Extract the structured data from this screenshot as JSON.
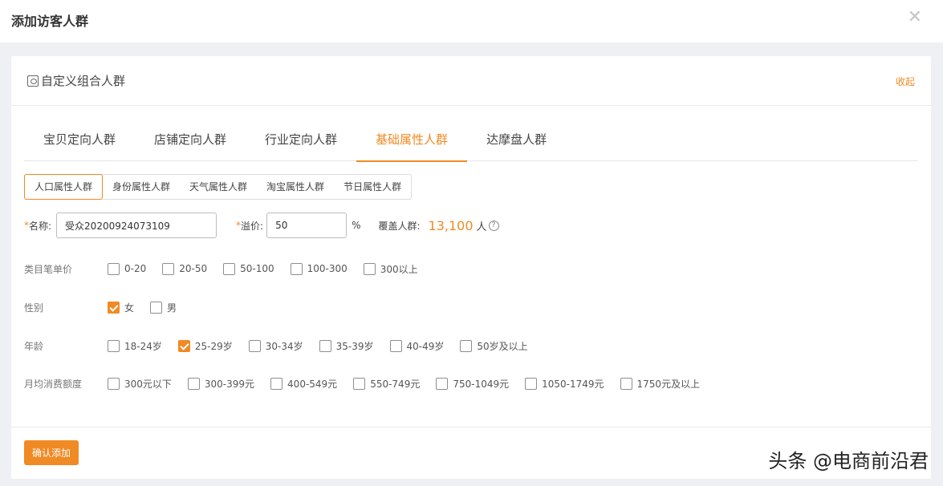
{
  "dialog": {
    "title": "添加访客人群",
    "close_icon": "close-icon"
  },
  "card": {
    "title": "自定义组合人群",
    "collapse_label": "收起"
  },
  "tabs": [
    {
      "label": "宝贝定向人群",
      "active": false
    },
    {
      "label": "店铺定向人群",
      "active": false
    },
    {
      "label": "行业定向人群",
      "active": false
    },
    {
      "label": "基础属性人群",
      "active": true
    },
    {
      "label": "达摩盘人群",
      "active": false
    }
  ],
  "subtabs": [
    {
      "label": "人口属性人群",
      "active": true
    },
    {
      "label": "身份属性人群",
      "active": false
    },
    {
      "label": "天气属性人群",
      "active": false
    },
    {
      "label": "淘宝属性人群",
      "active": false
    },
    {
      "label": "节日属性人群",
      "active": false
    }
  ],
  "form": {
    "required_mark": "*",
    "name_label": "名称:",
    "name_value": "受众20200924073109",
    "premium_label": "溢价:",
    "premium_value": "50",
    "premium_unit": "%",
    "coverage_label": "覆盖人群:",
    "coverage_value": "13,100",
    "coverage_unit": "人",
    "help_glyph": "?"
  },
  "options": {
    "price": {
      "label": "类目笔单价",
      "items": [
        {
          "label": "0-20",
          "checked": false
        },
        {
          "label": "20-50",
          "checked": false
        },
        {
          "label": "50-100",
          "checked": false
        },
        {
          "label": "100-300",
          "checked": false
        },
        {
          "label": "300以上",
          "checked": false
        }
      ]
    },
    "gender": {
      "label": "性别",
      "items": [
        {
          "label": "女",
          "checked": true
        },
        {
          "label": "男",
          "checked": false
        }
      ]
    },
    "age": {
      "label": "年龄",
      "items": [
        {
          "label": "18-24岁",
          "checked": false
        },
        {
          "label": "25-29岁",
          "checked": true
        },
        {
          "label": "30-34岁",
          "checked": false
        },
        {
          "label": "35-39岁",
          "checked": false
        },
        {
          "label": "40-49岁",
          "checked": false
        },
        {
          "label": "50岁及以上",
          "checked": false
        }
      ]
    },
    "spend": {
      "label": "月均消费额度",
      "items": [
        {
          "label": "300元以下",
          "checked": false
        },
        {
          "label": "300-399元",
          "checked": false
        },
        {
          "label": "400-549元",
          "checked": false
        },
        {
          "label": "550-749元",
          "checked": false
        },
        {
          "label": "750-1049元",
          "checked": false
        },
        {
          "label": "1050-1749元",
          "checked": false
        },
        {
          "label": "1750元及以上",
          "checked": false
        }
      ]
    }
  },
  "footer": {
    "confirm_label": "确认添加"
  },
  "watermark": "头条 @电商前沿君",
  "colors": {
    "accent": "#f08a24"
  }
}
